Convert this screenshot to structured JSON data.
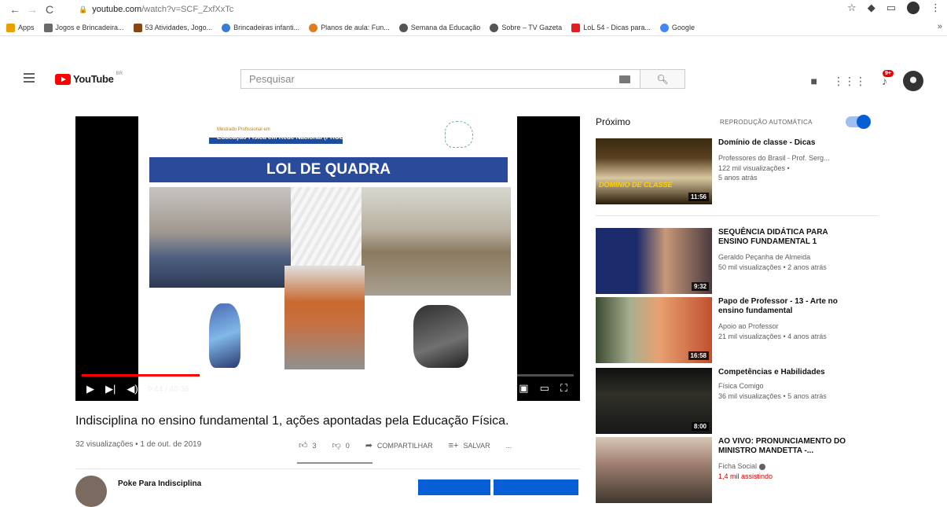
{
  "browser": {
    "url_host": "youtube.com",
    "url_path": "/watch?v=SCF_ZxfXxTc",
    "bookmarks": [
      {
        "label": "Apps",
        "color": "#e8a000"
      },
      {
        "label": "Jogos e Brincadeira...",
        "color": "#6a6a6a"
      },
      {
        "label": "53 Atividades, Jogo...",
        "color": "#8b4513"
      },
      {
        "label": "Brincadeiras infanti...",
        "color": "#3a7bd5"
      },
      {
        "label": "Planos de aula: Fun...",
        "color": "#e07b20"
      },
      {
        "label": "Semana da Educação",
        "color": "#555555"
      },
      {
        "label": "Sobre – TV Gazeta",
        "color": "#555555"
      },
      {
        "label": "LoL 54 - Dicas para...",
        "color": "#e02020"
      },
      {
        "label": "Google",
        "color": "#4285f4"
      }
    ]
  },
  "header": {
    "logo_text": "YouTube",
    "region": "BR",
    "search_placeholder": "Pesquisar",
    "notification_count": "9+",
    "accent": "#ff0000"
  },
  "player": {
    "slide_line1": "Mestrado Profissional em",
    "slide_line2": "Educação Física em Rede Nacional (PROEF)",
    "slide_title": "LOL DE QUADRA",
    "time": "9:44 / 40:36",
    "progress_fraction": 0.24
  },
  "video": {
    "title": "Indisciplina no ensino fundamental 1, ações apontadas pela Educação Física.",
    "meta": "32 visualizações • 1 de out. de 2019",
    "likes": "3",
    "dislikes": "0",
    "share_label": "COMPARTILHAR",
    "save_label": "SALVAR",
    "more_label": "...",
    "channel": "Poke Para Indisciplina"
  },
  "sidebar": {
    "up_next": "Próximo",
    "autoplay": "REPRODUÇÃO AUTOMÁTICA",
    "autoplay_on": true,
    "items": [
      {
        "title": "Domínio de classe - Dicas",
        "channel": "Professores do Brasil - Prof. Serg...",
        "stats1": "122 mil visualizações •",
        "stats2": "5 anos atrás",
        "duration": "11:56",
        "thumb_text": "DOMÍNIO DE CLASSE"
      },
      {
        "title": "SEQUÊNCIA DIDÁTICA PARA ENSINO FUNDAMENTAL 1",
        "channel": "Geraldo Peçanha de Almeida",
        "stats1": "50 mil visualizações • 2 anos atrás",
        "stats2": "",
        "duration": "9:32"
      },
      {
        "title": "Papo de Professor - 13 - Arte no ensino fundamental",
        "channel": "Apoio ao Professor",
        "stats1": "21 mil visualizações • 4 anos atrás",
        "stats2": "",
        "duration": "16:58"
      },
      {
        "title": "Competências e Habilidades",
        "channel": "Física Comigo",
        "stats1": "36 mil visualizações • 5 anos atrás",
        "stats2": "",
        "duration": "8:00"
      },
      {
        "title": "AO VIVO: PRONUNCIAMENTO DO MINISTRO MANDETTA -...",
        "channel": "Ficha Social",
        "stats1": "1,4 mil assistindo",
        "stats2": "",
        "duration": ""
      }
    ]
  }
}
